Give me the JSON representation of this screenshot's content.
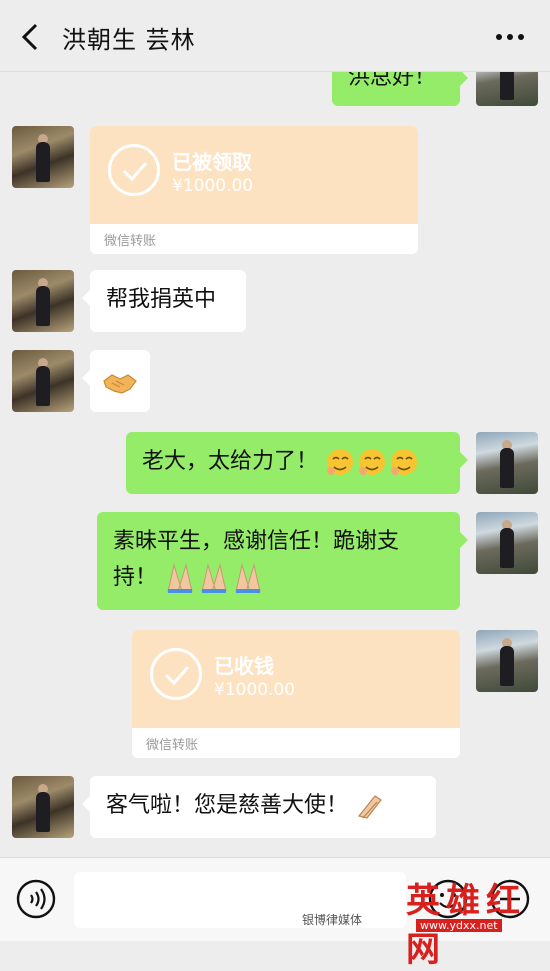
{
  "header": {
    "title": "洪朝生  芸林"
  },
  "messages": {
    "m0": {
      "text": "洪总好！"
    },
    "m1": {
      "status": "已被领取",
      "amount": "¥1000.00",
      "footer": "微信转账"
    },
    "m2": {
      "text": "帮我捐英中"
    },
    "m3": {
      "icon": "handshake-emoji"
    },
    "m4": {
      "text": "老大，太给力了！",
      "emoji": "smirk-emoji"
    },
    "m5": {
      "line1": "素昧平生，感谢信任！跪谢支",
      "line2": "持！",
      "emoji": "pray-emoji"
    },
    "m6": {
      "status": "已收钱",
      "amount": "¥1000.00",
      "footer": "微信转账"
    },
    "m7": {
      "text": "客气啦！您是慈善大使！",
      "emoji": "clap-emoji"
    }
  },
  "inputbar": {
    "placeholder": ""
  },
  "watermark": {
    "big": "英雄红网",
    "small": "www.ydxx.net",
    "tag": "银博律媒体"
  },
  "colors": {
    "background": "#ededed",
    "outgoing_bubble": "#95ec69",
    "incoming_bubble": "#ffffff",
    "transfer_card": "#fde2c2",
    "watermark_red": "#d6211f"
  }
}
